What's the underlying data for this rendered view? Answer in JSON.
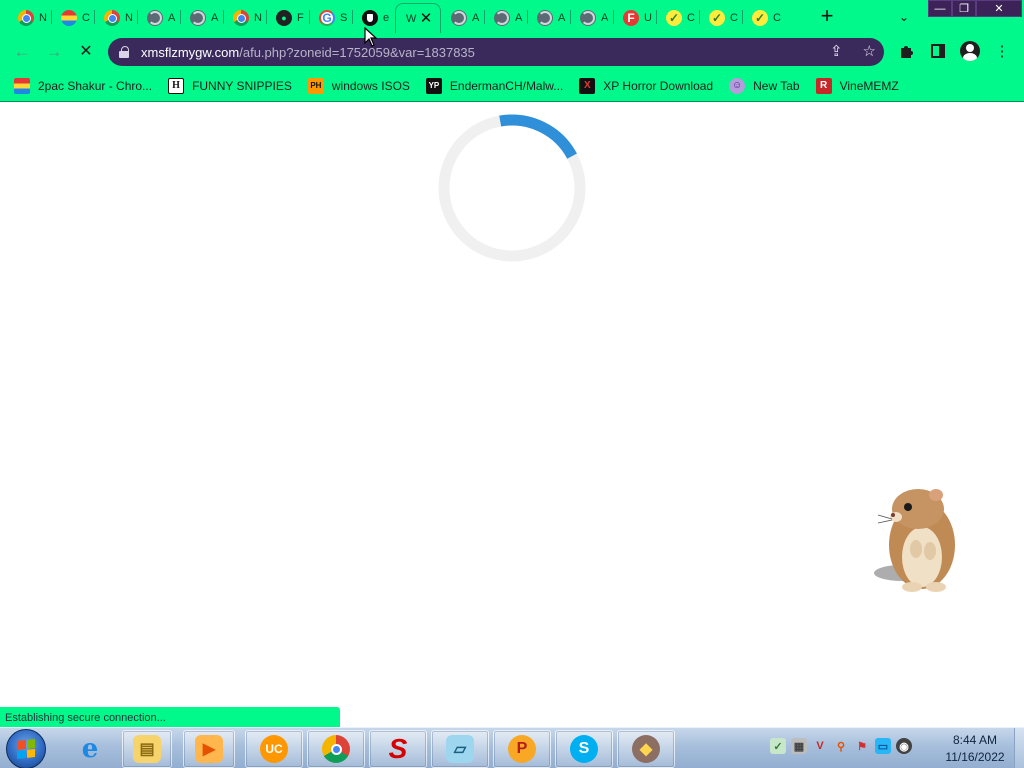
{
  "browser": {
    "tabs": [
      {
        "title": "N",
        "icon": "chrome-icon"
      },
      {
        "title": "C",
        "icon": "rainbow-icon"
      },
      {
        "title": "N",
        "icon": "chrome-icon"
      },
      {
        "title": "A",
        "icon": "globe-icon"
      },
      {
        "title": "A",
        "icon": "globe-icon"
      },
      {
        "title": "N",
        "icon": "chrome-icon"
      },
      {
        "title": "F",
        "icon": "dark-logo-icon"
      },
      {
        "title": "S",
        "icon": "google-icon"
      },
      {
        "title": "e",
        "icon": "shield-icon"
      },
      {
        "title": "W",
        "icon": "none",
        "active": true
      },
      {
        "title": "A",
        "icon": "globe-icon"
      },
      {
        "title": "A",
        "icon": "globe-icon"
      },
      {
        "title": "A",
        "icon": "globe-icon"
      },
      {
        "title": "A",
        "icon": "globe-icon"
      },
      {
        "title": "U",
        "icon": "f-logo-icon"
      },
      {
        "title": "C",
        "icon": "check-icon"
      },
      {
        "title": "C",
        "icon": "check-icon"
      },
      {
        "title": "C",
        "icon": "check-icon"
      }
    ],
    "new_tab_label": "+",
    "close_label": "✕",
    "tab_search_label": "⌄",
    "window_controls": {
      "minimize": "—",
      "maximize": "❐",
      "close": "✕"
    },
    "omnibox": {
      "host": "xmsflzmygw.com",
      "path": "/afu.php?zoneid=1752059&var=1837835"
    },
    "bookmarks": [
      {
        "label": "2pac Shakur - Chro...",
        "icon": "rainbow-icon",
        "glyph": ""
      },
      {
        "label": "FUNNY SNIPPIES",
        "icon": "h-logo-icon",
        "glyph": "H"
      },
      {
        "label": "windows ISOS",
        "icon": "ph-logo-icon",
        "glyph": "PH"
      },
      {
        "label": "EndermanCH/Malw...",
        "icon": "yp-logo-icon",
        "glyph": "YP"
      },
      {
        "label": "XP Horror Download",
        "icon": "x-logo-icon",
        "glyph": "X"
      },
      {
        "label": "New Tab",
        "icon": "smiley-icon",
        "glyph": "☺"
      },
      {
        "label": "VineMEMZ",
        "icon": "r-logo-icon",
        "glyph": "R"
      }
    ],
    "status_text": "Establishing secure connection...",
    "loading_progress": 0.2,
    "colors": {
      "frame": "#00f98a",
      "omnibox": "#3a2a5c",
      "spinner": "#2f8fd8"
    }
  },
  "taskbar": {
    "apps": [
      {
        "name": "internet-explorer",
        "glyph": "e"
      },
      {
        "name": "file-explorer",
        "glyph": "▤"
      },
      {
        "name": "media-player",
        "glyph": "▶"
      },
      {
        "name": "uc-browser",
        "glyph": "UC"
      },
      {
        "name": "chrome",
        "glyph": ""
      },
      {
        "name": "s-app",
        "glyph": "S"
      },
      {
        "name": "notepad-app",
        "glyph": "▱"
      },
      {
        "name": "p-app",
        "glyph": "P"
      },
      {
        "name": "skype",
        "glyph": "S"
      },
      {
        "name": "agent-app",
        "glyph": "◆"
      }
    ],
    "tray": [
      "✓",
      "▦",
      "V",
      "⚲",
      "⚑",
      "▭",
      "◉"
    ],
    "time": "8:44 AM",
    "date": "11/16/2022"
  }
}
